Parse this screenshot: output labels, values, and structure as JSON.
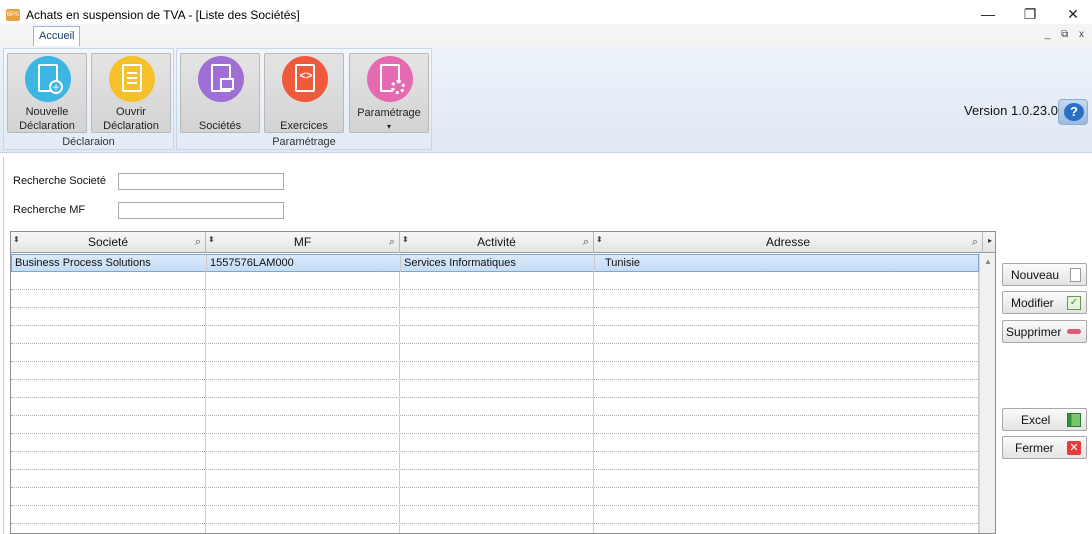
{
  "window": {
    "app_icon_text": "BPS",
    "title": "Achats en suspension de TVA - [Liste des Sociétés]",
    "minimize": "—",
    "restore": "❐",
    "close": "✕"
  },
  "ribbon": {
    "tab": "Accueil",
    "mdi_controls": "_ ⧉ x",
    "version": "Version 1.0.23.0",
    "help_glyph": "?",
    "groups": [
      {
        "label": "Déclaraion",
        "buttons": [
          {
            "line1": "Nouvelle",
            "line2": "Déclaration",
            "icon": "new-document-icon",
            "color": "#3cb6e3"
          },
          {
            "line1": "Ouvrir",
            "line2": "Déclaration",
            "icon": "open-document-icon",
            "color": "#f5c12b"
          }
        ]
      },
      {
        "label": "Paramétrage",
        "buttons": [
          {
            "line1": "Sociétés",
            "icon": "company-icon",
            "color": "#9f6fd6"
          },
          {
            "line1": "Exercices",
            "icon": "code-document-icon",
            "color": "#f05a3c"
          },
          {
            "line1": "Paramétrage",
            "line2": "▾",
            "icon": "settings-document-icon",
            "color": "#e56ab1"
          }
        ]
      }
    ]
  },
  "search": {
    "societe_label": "Recherche Societé",
    "societe_value": "",
    "mf_label": "Recherche MF",
    "mf_value": ""
  },
  "grid": {
    "columns": [
      "Societé",
      "MF",
      "Activité",
      "Adresse"
    ],
    "rows": [
      [
        "Business Process Solutions",
        "1557576LAM000",
        "Services Informatiques",
        "Tunisie"
      ]
    ],
    "empty_rows": 15
  },
  "actions": {
    "nouveau": "Nouveau",
    "modifier": "Modifier",
    "supprimer": "Supprimer",
    "excel": "Excel",
    "fermer": "Fermer"
  }
}
